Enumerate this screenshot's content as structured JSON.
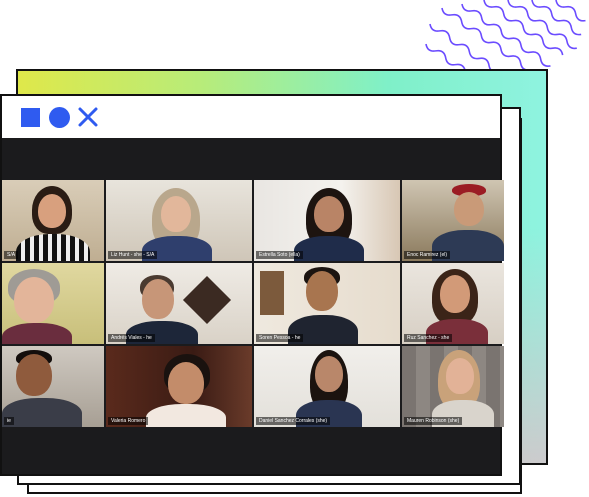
{
  "colors": {
    "accent_blue": "#2f5bf0",
    "wave_purple": "#6b4cff",
    "active_speaker": "#f0e14a"
  },
  "window_controls": {
    "icons": [
      "square-icon",
      "circle-icon",
      "close-icon"
    ]
  },
  "participants": [
    {
      "label": "S/A",
      "active": true
    },
    {
      "label": "Liz Hunt - she - S/A"
    },
    {
      "label": "Estrella Soto (ella)"
    },
    {
      "label": "Enoc Ramirez (el)"
    },
    {
      "label": ""
    },
    {
      "label": "Andrés Viales - he"
    },
    {
      "label": "Soren Pessoa - he"
    },
    {
      "label": "Ruz Sanchez - she"
    },
    {
      "label": "ie"
    },
    {
      "label": "Valeria Romero"
    },
    {
      "label": "Daniel Sanchez Corrales (she)"
    },
    {
      "label": "Mauren Robinson (she)"
    }
  ]
}
